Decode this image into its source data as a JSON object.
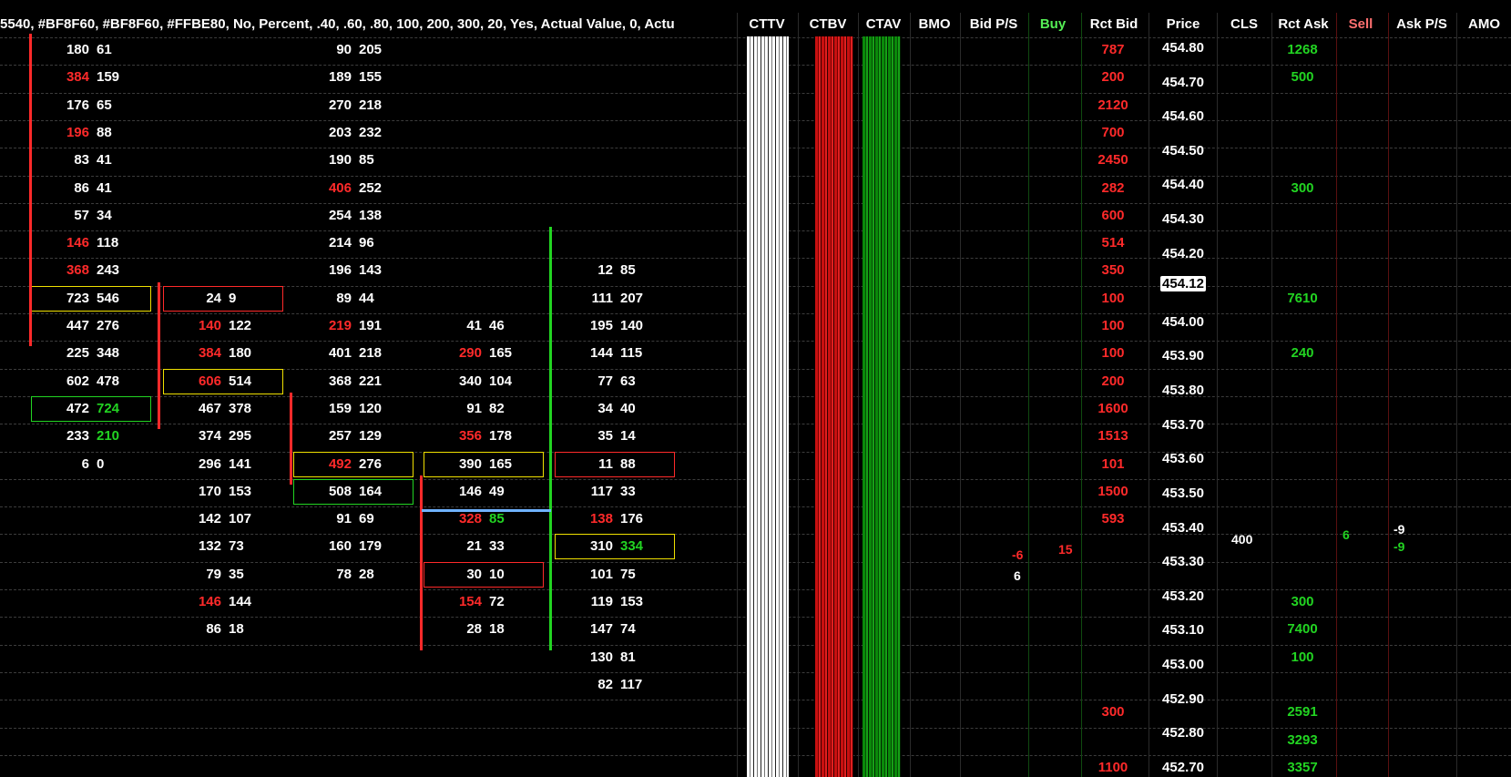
{
  "study_header": "5540, #BF8F60, #BF8F60, #FFBE80, No, Percent, .40, .60, .80, 100, 200, 300, 20, Yes, Actual Value, 0, Actu",
  "colors": {
    "red": "#ff2a2a",
    "green": "#22d422",
    "yellow": "#f0e000",
    "white": "#ffffff",
    "grid": "#3c3c3c",
    "blue_line": "#6fb2ff",
    "sell_header": "#ff7070",
    "buy_header": "#55ee55"
  },
  "dom_columns": [
    {
      "key": "cttv",
      "label": "CTTV",
      "color": "#ffffff"
    },
    {
      "key": "ctbv",
      "label": "CTBV",
      "color": "#ffffff"
    },
    {
      "key": "ctav",
      "label": "CTAV",
      "color": "#ffffff"
    },
    {
      "key": "bmo",
      "label": "BMO",
      "color": "#ffffff"
    },
    {
      "key": "bid_ps",
      "label": "Bid P/S",
      "color": "#ffffff"
    },
    {
      "key": "buy",
      "label": "Buy",
      "color": "#55ee55"
    },
    {
      "key": "rct_bid",
      "label": "Rct Bid",
      "color": "#ffffff"
    },
    {
      "key": "price",
      "label": "Price",
      "color": "#ffffff"
    },
    {
      "key": "cls",
      "label": "CLS",
      "color": "#ffffff"
    },
    {
      "key": "rct_ask",
      "label": "Rct Ask",
      "color": "#ffffff"
    },
    {
      "key": "sell",
      "label": "Sell",
      "color": "#ff7070"
    },
    {
      "key": "ask_ps",
      "label": "Ask P/S",
      "color": "#ffffff"
    },
    {
      "key": "amo",
      "label": "AMO",
      "color": "#ffffff"
    }
  ],
  "prices": [
    "454.80",
    "454.70",
    "454.60",
    "454.50",
    "454.40",
    "454.30",
    "454.20",
    "454.12",
    "454.00",
    "453.90",
    "453.80",
    "453.70",
    "453.60",
    "453.50",
    "453.40",
    "453.30",
    "453.20",
    "453.10",
    "453.00",
    "452.90",
    "452.80",
    "452.70"
  ],
  "current_price": "454.12",
  "rct_bid": [
    {
      "row": 0,
      "v": "787"
    },
    {
      "row": 1,
      "v": "200"
    },
    {
      "row": 2,
      "v": "2120"
    },
    {
      "row": 3,
      "v": "700"
    },
    {
      "row": 4,
      "v": "2450"
    },
    {
      "row": 5,
      "v": "282"
    },
    {
      "row": 6,
      "v": "600"
    },
    {
      "row": 7,
      "v": "514"
    },
    {
      "row": 8,
      "v": "350"
    },
    {
      "row": 9,
      "v": "100"
    },
    {
      "row": 10,
      "v": "100"
    },
    {
      "row": 11,
      "v": "100"
    },
    {
      "row": 12,
      "v": "200"
    },
    {
      "row": 13,
      "v": "1600"
    },
    {
      "row": 14,
      "v": "1513"
    },
    {
      "row": 15,
      "v": "101"
    },
    {
      "row": 16,
      "v": "1500"
    },
    {
      "row": 17,
      "v": "593"
    },
    {
      "row": 24,
      "v": "300"
    },
    {
      "row": 26,
      "v": "1100"
    }
  ],
  "rct_ask": [
    {
      "row": 0,
      "v": "1268"
    },
    {
      "row": 1,
      "v": "500"
    },
    {
      "row": 5,
      "v": "300"
    },
    {
      "row": 9,
      "v": "7610"
    },
    {
      "row": 11,
      "v": "240"
    },
    {
      "row": 20,
      "v": "300"
    },
    {
      "row": 21,
      "v": "7400"
    },
    {
      "row": 22,
      "v": "100"
    },
    {
      "row": 24,
      "v": "2591"
    },
    {
      "row": 25,
      "v": "3293"
    },
    {
      "row": 26,
      "v": "3357"
    }
  ],
  "misc": {
    "cls_value": "400",
    "sell_value": "6",
    "ask_ps_top": "-9",
    "ask_ps_bottom": "-9",
    "bid_ps_top": "-6",
    "bid_ps_bottom": "6",
    "buy_value": "15"
  },
  "footprint": [
    {
      "col": 0,
      "rows": [
        {
          "r": 0,
          "b": "180",
          "a": "61"
        },
        {
          "r": 1,
          "b": "384",
          "a": "159",
          "bc": "red"
        },
        {
          "r": 2,
          "b": "176",
          "a": "65"
        },
        {
          "r": 3,
          "b": "196",
          "a": "88",
          "bc": "red"
        },
        {
          "r": 4,
          "b": "83",
          "a": "41"
        },
        {
          "r": 5,
          "b": "86",
          "a": "41"
        },
        {
          "r": 6,
          "b": "57",
          "a": "34"
        },
        {
          "r": 7,
          "b": "146",
          "a": "118",
          "bc": "red"
        },
        {
          "r": 8,
          "b": "368",
          "a": "243",
          "bc": "red"
        },
        {
          "r": 9,
          "b": "723",
          "a": "546",
          "box": "yellow"
        },
        {
          "r": 10,
          "b": "447",
          "a": "276"
        },
        {
          "r": 11,
          "b": "225",
          "a": "348"
        },
        {
          "r": 12,
          "b": "602",
          "a": "478"
        },
        {
          "r": 13,
          "b": "472",
          "a": "724",
          "ac": "green",
          "box": "green"
        },
        {
          "r": 14,
          "b": "233",
          "a": "210",
          "ac": "green"
        },
        {
          "r": 15,
          "b": "6",
          "a": "0"
        }
      ]
    },
    {
      "col": 1,
      "rows": [
        {
          "r": 9,
          "b": "24",
          "a": "9",
          "box": "red"
        },
        {
          "r": 10,
          "b": "140",
          "a": "122",
          "bc": "red"
        },
        {
          "r": 11,
          "b": "384",
          "a": "180",
          "bc": "red"
        },
        {
          "r": 12,
          "b": "606",
          "a": "514",
          "bc": "red",
          "box": "yellow"
        },
        {
          "r": 13,
          "b": "467",
          "a": "378"
        },
        {
          "r": 14,
          "b": "374",
          "a": "295"
        },
        {
          "r": 15,
          "b": "296",
          "a": "141"
        },
        {
          "r": 16,
          "b": "170",
          "a": "153"
        },
        {
          "r": 17,
          "b": "142",
          "a": "107"
        },
        {
          "r": 18,
          "b": "132",
          "a": "73"
        },
        {
          "r": 19,
          "b": "79",
          "a": "35"
        },
        {
          "r": 20,
          "b": "146",
          "a": "144",
          "bc": "red"
        },
        {
          "r": 21,
          "b": "86",
          "a": "18"
        }
      ]
    },
    {
      "col": 2,
      "rows": [
        {
          "r": 0,
          "b": "90",
          "a": "205"
        },
        {
          "r": 1,
          "b": "189",
          "a": "155"
        },
        {
          "r": 2,
          "b": "270",
          "a": "218"
        },
        {
          "r": 3,
          "b": "203",
          "a": "232"
        },
        {
          "r": 4,
          "b": "190",
          "a": "85"
        },
        {
          "r": 5,
          "b": "406",
          "a": "252",
          "bc": "red"
        },
        {
          "r": 6,
          "b": "254",
          "a": "138"
        },
        {
          "r": 7,
          "b": "214",
          "a": "96"
        },
        {
          "r": 8,
          "b": "196",
          "a": "143"
        },
        {
          "r": 9,
          "b": "89",
          "a": "44"
        },
        {
          "r": 10,
          "b": "219",
          "a": "191",
          "bc": "red"
        },
        {
          "r": 11,
          "b": "401",
          "a": "218"
        },
        {
          "r": 12,
          "b": "368",
          "a": "221"
        },
        {
          "r": 13,
          "b": "159",
          "a": "120"
        },
        {
          "r": 14,
          "b": "257",
          "a": "129"
        },
        {
          "r": 15,
          "b": "492",
          "a": "276",
          "bc": "red",
          "box": "yellow"
        },
        {
          "r": 16,
          "b": "508",
          "a": "164",
          "box": "green"
        },
        {
          "r": 17,
          "b": "91",
          "a": "69"
        },
        {
          "r": 18,
          "b": "160",
          "a": "179"
        },
        {
          "r": 19,
          "b": "78",
          "a": "28"
        }
      ]
    },
    {
      "col": 3,
      "rows": [
        {
          "r": 10,
          "b": "41",
          "a": "46"
        },
        {
          "r": 11,
          "b": "290",
          "a": "165",
          "bc": "red"
        },
        {
          "r": 12,
          "b": "340",
          "a": "104"
        },
        {
          "r": 13,
          "b": "91",
          "a": "82"
        },
        {
          "r": 14,
          "b": "356",
          "a": "178",
          "bc": "red"
        },
        {
          "r": 15,
          "b": "390",
          "a": "165",
          "box": "yellow"
        },
        {
          "r": 16,
          "b": "146",
          "a": "49"
        },
        {
          "r": 17,
          "b": "328",
          "a": "85",
          "bc": "red",
          "ac": "green"
        },
        {
          "r": 18,
          "b": "21",
          "a": "33"
        },
        {
          "r": 19,
          "b": "30",
          "a": "10",
          "box": "red"
        },
        {
          "r": 20,
          "b": "154",
          "a": "72",
          "bc": "red"
        },
        {
          "r": 21,
          "b": "28",
          "a": "18"
        }
      ]
    },
    {
      "col": 4,
      "rows": [
        {
          "r": 8,
          "b": "12",
          "a": "85"
        },
        {
          "r": 9,
          "b": "111",
          "a": "207"
        },
        {
          "r": 10,
          "b": "195",
          "a": "140"
        },
        {
          "r": 11,
          "b": "144",
          "a": "115"
        },
        {
          "r": 12,
          "b": "77",
          "a": "63"
        },
        {
          "r": 13,
          "b": "34",
          "a": "40"
        },
        {
          "r": 14,
          "b": "35",
          "a": "14"
        },
        {
          "r": 15,
          "b": "11",
          "a": "88",
          "box": "red"
        },
        {
          "r": 16,
          "b": "117",
          "a": "33"
        },
        {
          "r": 17,
          "b": "138",
          "a": "176",
          "bc": "red"
        },
        {
          "r": 18,
          "b": "310",
          "a": "334",
          "ac": "green",
          "box": "yellow"
        },
        {
          "r": 19,
          "b": "101",
          "a": "75"
        },
        {
          "r": 20,
          "b": "119",
          "a": "153"
        },
        {
          "r": 21,
          "b": "147",
          "a": "74"
        },
        {
          "r": 22,
          "b": "130",
          "a": "81"
        },
        {
          "r": 23,
          "b": "82",
          "a": "117"
        }
      ]
    }
  ]
}
